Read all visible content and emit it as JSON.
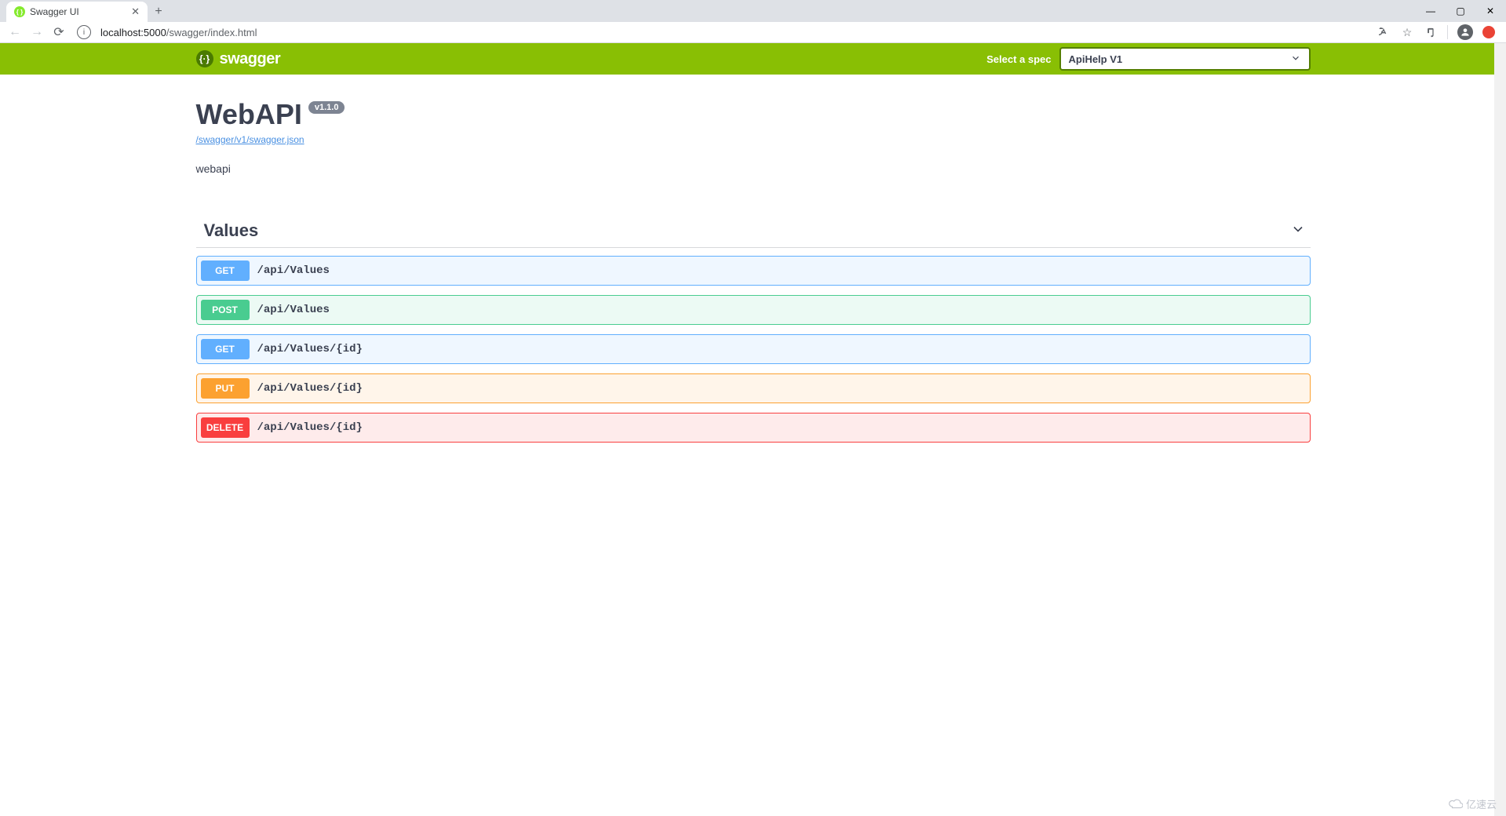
{
  "browser": {
    "tab_title": "Swagger UI",
    "url_host": "localhost:5000",
    "url_path": "/swagger/index.html"
  },
  "topbar": {
    "logo_text": "swagger",
    "spec_label": "Select a spec",
    "spec_selected": "ApiHelp V1"
  },
  "info": {
    "title": "WebAPI",
    "version": "v1.1.0",
    "spec_url": "/swagger/v1/swagger.json",
    "description": "webapi"
  },
  "tag": {
    "name": "Values"
  },
  "operations": [
    {
      "method": "GET",
      "path": "/api/Values"
    },
    {
      "method": "POST",
      "path": "/api/Values"
    },
    {
      "method": "GET",
      "path": "/api/Values/{id}"
    },
    {
      "method": "PUT",
      "path": "/api/Values/{id}"
    },
    {
      "method": "DELETE",
      "path": "/api/Values/{id}"
    }
  ],
  "watermark": "亿速云"
}
